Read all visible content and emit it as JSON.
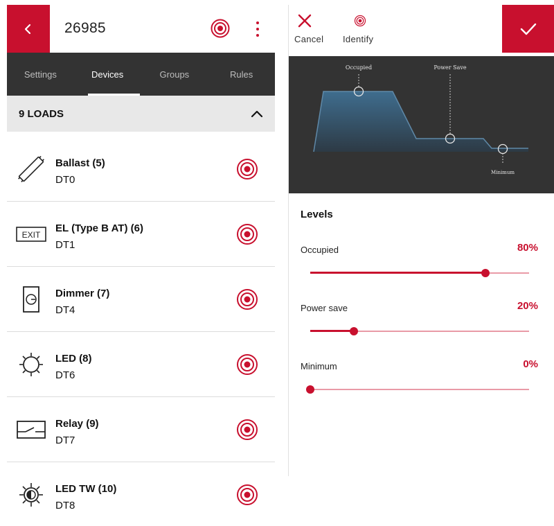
{
  "left": {
    "title": "26985",
    "tabs": [
      {
        "label": "Settings",
        "active": false
      },
      {
        "label": "Devices",
        "active": true
      },
      {
        "label": "Groups",
        "active": false
      },
      {
        "label": "Rules",
        "active": false
      }
    ],
    "loads_header": "9 LOADS",
    "devices": [
      {
        "name": "Ballast (5)",
        "type": "DT0",
        "icon": "ballast-icon"
      },
      {
        "name": "EL (Type B AT) (6)",
        "type": "DT1",
        "icon": "exit-sign-icon",
        "icon_text": "EXIT"
      },
      {
        "name": "Dimmer (7)",
        "type": "DT4",
        "icon": "dimmer-icon"
      },
      {
        "name": "LED (8)",
        "type": "DT6",
        "icon": "led-icon"
      },
      {
        "name": "Relay (9)",
        "type": "DT7",
        "icon": "relay-icon"
      },
      {
        "name": "LED TW (10)",
        "type": "DT8",
        "icon": "led-tw-icon"
      }
    ]
  },
  "right": {
    "cancel_label": "Cancel",
    "identify_label": "Identify",
    "graph": {
      "occupied_label": "Occupied",
      "power_save_label": "Power Save",
      "minimum_label": "Minimum"
    },
    "levels_title": "Levels",
    "levels": [
      {
        "label": "Occupied",
        "value": "80%",
        "fraction": 0.8
      },
      {
        "label": "Power save",
        "value": "20%",
        "fraction": 0.2
      },
      {
        "label": "Minimum",
        "value": "0%",
        "fraction": 0.0
      }
    ]
  },
  "colors": {
    "accent": "#c8102e",
    "dark_bar": "#333333",
    "header_bg": "#e8e8e8",
    "track_light": "#e99aa6"
  }
}
